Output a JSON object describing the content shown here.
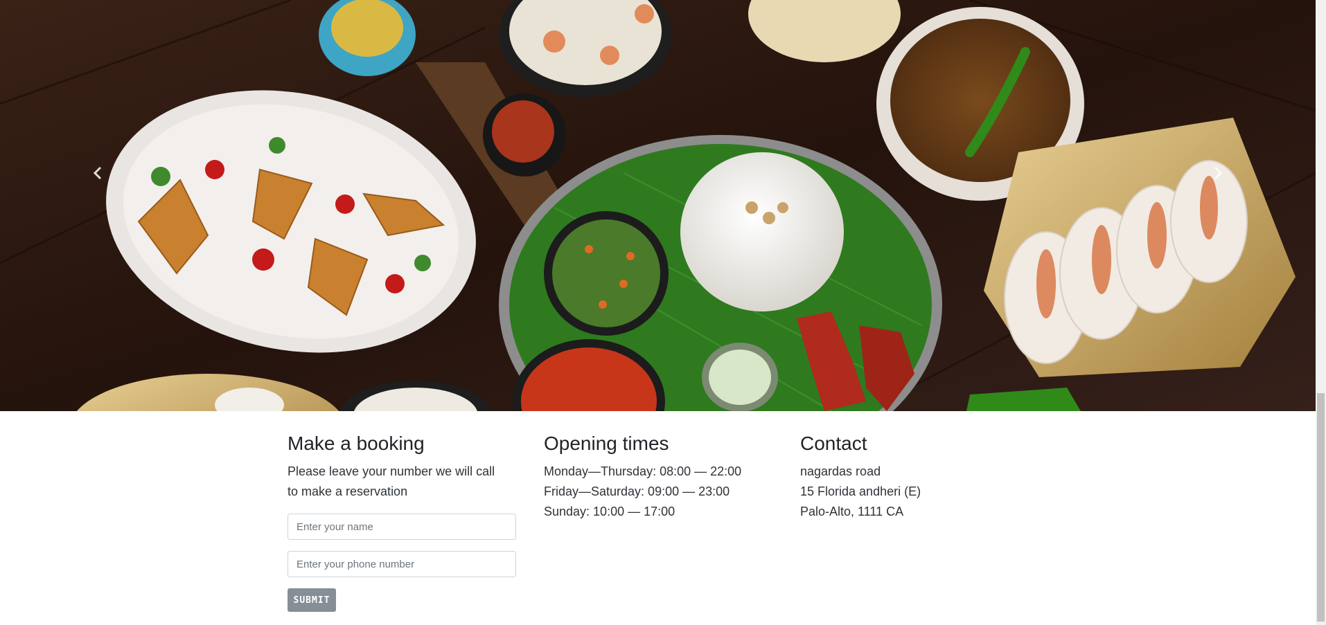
{
  "carousel": {
    "prev_icon": "chevron-left-icon",
    "next_icon": "chevron-right-icon",
    "slide_description_icon": "food-spread-image"
  },
  "booking": {
    "title": "Make a booking",
    "description_line1": "Please leave your number we will call",
    "description_line2": "to make a reservation",
    "name_placeholder": "Enter your name",
    "phone_placeholder": "Enter your phone number",
    "submit_label": "SUBMIT"
  },
  "opening": {
    "title": "Opening times",
    "lines": [
      "Monday—Thursday: 08:00 — 22:00",
      "Friday—Saturday: 09:00 — 23:00",
      "Sunday: 10:00 — 17:00"
    ]
  },
  "contact": {
    "title": "Contact",
    "lines": [
      "nagardas road",
      "15 Florida andheri (E)",
      "Palo-Alto, 1111 CA"
    ]
  },
  "colors": {
    "table_wood": "#2a1710",
    "submit_bg": "#868e96",
    "banana_leaf": "#2f7a1f"
  }
}
